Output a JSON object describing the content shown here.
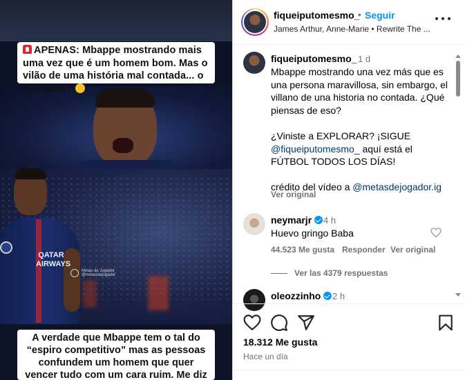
{
  "video": {
    "caption_top": "APENAS: Mbappe mostrando mais uma vez que é um homem bom. Mas o vilão de uma história mal contada... o que acha?",
    "caption_bottom": "A verdade que Mbappe tem o tal do “espiro competitivo” mas as pessoas confundem um homem que quer vencer tudo com um cara ruim. Me diz o que você pensa disso?",
    "jersey_sponsor": "QATAR AIRWAYS",
    "watermark_title": "Metas de Jogador",
    "watermark_handle": "@metasdejogador"
  },
  "header": {
    "username": "fiqueiputomesmo_",
    "separator": "•",
    "follow_label": "Seguir",
    "music": "James Arthur, Anne-Marie • Rewrite The ..."
  },
  "caption": {
    "username": "fiqueiputomesmo_",
    "time": "1 d",
    "line1": "Mbappe mostrando una vez más que es una persona maravillosa, sin embargo, el villano de una historia no contada. ¿Qué piensas de eso?",
    "line2_pre": "¿Viniste a EXPLORAR? ¡SIGUE ",
    "line2_mention": "@fiqueiputomesmo_",
    "line2_post": " aquí está el FÚTBOL TODOS LOS DÍAS!",
    "line3_pre": "crédito del vídeo a ",
    "line3_mention": "@metasdejogador.ig",
    "see_translation": "Ver original"
  },
  "comments": [
    {
      "username": "neymarjr",
      "time": "4 h",
      "text": "Huevo gringo Baba",
      "likes": "44.523 Me gusta",
      "reply_label": "Responder",
      "see_original": "Ver original",
      "replies_label": "Ver las 4379 respuestas"
    },
    {
      "username": "oleozzinho",
      "time": "2 h"
    }
  ],
  "actions": {
    "like_icon": "heart-icon",
    "comment_icon": "comment-icon",
    "share_icon": "share-icon",
    "save_icon": "bookmark-icon"
  },
  "stats": {
    "likes": "18.312 Me gusta",
    "posted": "Hace un día"
  },
  "colors": {
    "link": "#0095f6",
    "mention": "#00376b",
    "muted": "#737373",
    "verified": "#0095f6"
  }
}
